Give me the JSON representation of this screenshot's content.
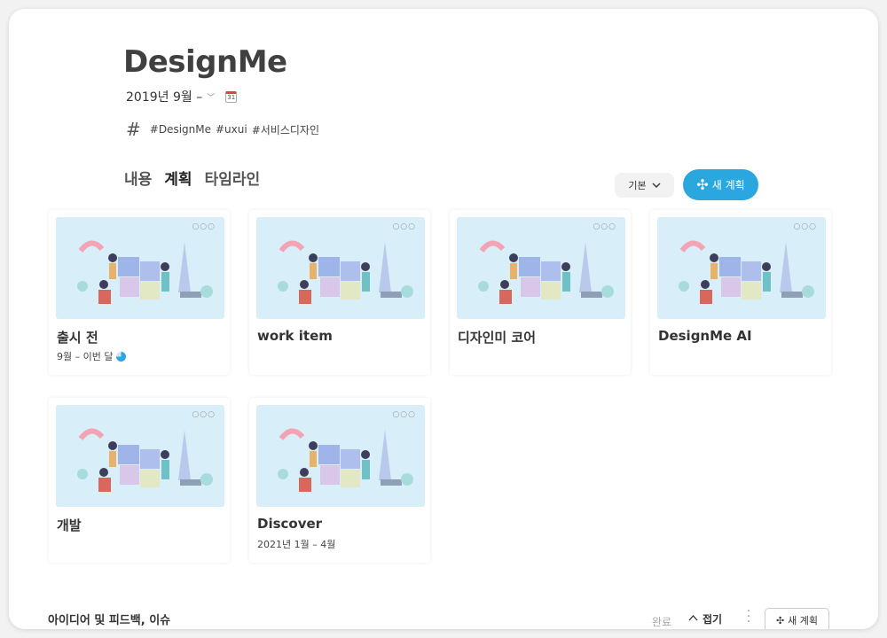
{
  "header": {
    "title": "DesignMe",
    "date_range": "2019년 9월 –",
    "calendar_day": "31",
    "tags": [
      "#DesignMe",
      "#uxui",
      "#서비스디자인"
    ]
  },
  "tabs": [
    {
      "label": "내용",
      "active": false
    },
    {
      "label": "계획",
      "active": true
    },
    {
      "label": "타임라인",
      "active": false
    }
  ],
  "toolbar": {
    "view_label": "기본",
    "new_plan_label": "새 계획"
  },
  "cards": [
    {
      "title": "출시 전",
      "subtitle": "9월 – 이번 달",
      "has_progress": true
    },
    {
      "title": "work item",
      "subtitle": ""
    },
    {
      "title": "디자인미 코어",
      "subtitle": ""
    },
    {
      "title": "DesignMe AI",
      "subtitle": ""
    },
    {
      "title": "개발",
      "subtitle": ""
    },
    {
      "title": "Discover",
      "subtitle": "2021년 1월 – 4월"
    }
  ],
  "card_menu_glyph": "○○○",
  "bottom": {
    "section_title": "아이디어 및 피드백, 이슈",
    "done_label": "완료",
    "fold_label": "접기",
    "new_plan_label": "새 계획"
  },
  "colors": {
    "accent": "#2aa7df",
    "card_image_bg": "#d8effa",
    "tab_underline": "#7cc4e4"
  }
}
